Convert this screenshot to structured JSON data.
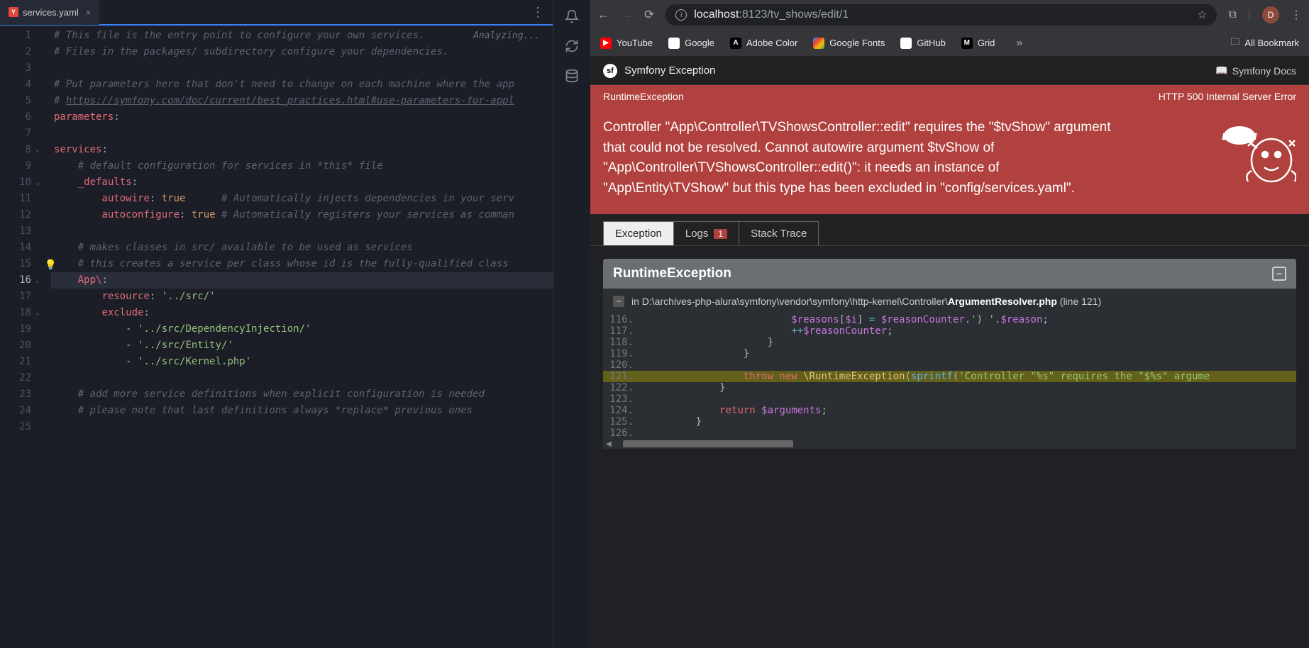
{
  "editor": {
    "tab": {
      "filename": "services.yaml",
      "iconLetter": "Y"
    },
    "status": "Analyzing...",
    "lines": [
      {
        "n": 1,
        "seg": [
          [
            "c-comment",
            "# This file is the entry point to configure your own services."
          ]
        ]
      },
      {
        "n": 2,
        "seg": [
          [
            "c-comment",
            "# Files in the packages/ subdirectory configure your dependencies."
          ]
        ]
      },
      {
        "n": 3,
        "seg": []
      },
      {
        "n": 4,
        "seg": [
          [
            "c-comment",
            "# Put parameters here that don't need to change on each machine where the app"
          ]
        ]
      },
      {
        "n": 5,
        "seg": [
          [
            "c-comment",
            "# "
          ],
          [
            "c-link",
            "https://symfony.com/doc/current/best_practices.html#use-parameters-for-appl"
          ]
        ]
      },
      {
        "n": 6,
        "seg": [
          [
            "c-key",
            "parameters"
          ],
          [
            "c-punc",
            ":"
          ]
        ]
      },
      {
        "n": 7,
        "seg": []
      },
      {
        "n": 8,
        "chev": "v",
        "seg": [
          [
            "c-key",
            "services"
          ],
          [
            "c-punc",
            ":"
          ]
        ]
      },
      {
        "n": 9,
        "seg": [
          [
            "",
            "    "
          ],
          [
            "c-comment",
            "# default configuration for services in *this* file"
          ]
        ]
      },
      {
        "n": 10,
        "chev": "v",
        "seg": [
          [
            "",
            "    "
          ],
          [
            "c-key",
            "_defaults"
          ],
          [
            "c-punc",
            ":"
          ]
        ]
      },
      {
        "n": 11,
        "seg": [
          [
            "",
            "        "
          ],
          [
            "c-key",
            "autowire"
          ],
          [
            "c-punc",
            ": "
          ],
          [
            "c-val",
            "true"
          ],
          [
            "",
            "      "
          ],
          [
            "c-comment",
            "# Automatically injects dependencies in your serv"
          ]
        ]
      },
      {
        "n": 12,
        "seg": [
          [
            "",
            "        "
          ],
          [
            "c-key",
            "autoconfigure"
          ],
          [
            "c-punc",
            ": "
          ],
          [
            "c-val",
            "true"
          ],
          [
            "",
            " "
          ],
          [
            "c-comment",
            "# Automatically registers your services as comman"
          ]
        ]
      },
      {
        "n": 13,
        "seg": []
      },
      {
        "n": 14,
        "seg": [
          [
            "",
            "    "
          ],
          [
            "c-comment",
            "# makes classes in src/ available to be used as services"
          ]
        ]
      },
      {
        "n": 15,
        "bulb": true,
        "seg": [
          [
            "",
            "    "
          ],
          [
            "c-comment",
            "# this creates a service per class whose id is the fully-qualified class"
          ]
        ]
      },
      {
        "n": 16,
        "chev": "v",
        "active": true,
        "seg": [
          [
            "",
            "    "
          ],
          [
            "c-key",
            "App\\"
          ],
          [
            "c-punc",
            ":"
          ]
        ]
      },
      {
        "n": 17,
        "seg": [
          [
            "",
            "        "
          ],
          [
            "c-key",
            "resource"
          ],
          [
            "c-punc",
            ": "
          ],
          [
            "c-str",
            "'../src/'"
          ]
        ]
      },
      {
        "n": 18,
        "chev": "v",
        "seg": [
          [
            "",
            "        "
          ],
          [
            "c-key",
            "exclude"
          ],
          [
            "c-punc",
            ":"
          ]
        ]
      },
      {
        "n": 19,
        "seg": [
          [
            "",
            "            "
          ],
          [
            "c-punc",
            "- "
          ],
          [
            "c-str",
            "'../src/DependencyInjection/'"
          ]
        ]
      },
      {
        "n": 20,
        "seg": [
          [
            "",
            "            "
          ],
          [
            "c-punc",
            "- "
          ],
          [
            "c-str",
            "'../src/Entity/'"
          ]
        ]
      },
      {
        "n": 21,
        "seg": [
          [
            "",
            "            "
          ],
          [
            "c-punc",
            "- "
          ],
          [
            "c-str",
            "'../src/Kernel.php'"
          ]
        ]
      },
      {
        "n": 22,
        "seg": []
      },
      {
        "n": 23,
        "seg": [
          [
            "",
            "    "
          ],
          [
            "c-comment",
            "# add more service definitions when explicit configuration is needed"
          ]
        ]
      },
      {
        "n": 24,
        "seg": [
          [
            "",
            "    "
          ],
          [
            "c-comment",
            "# please note that last definitions always *replace* previous ones"
          ]
        ]
      },
      {
        "n": 25,
        "seg": []
      }
    ]
  },
  "browser": {
    "url_host": "localhost",
    "url_path": ":8123/tv_shows/edit/1",
    "avatar_letter": "D",
    "bookmarks": [
      {
        "icon": "fi-yt",
        "label": "YouTube",
        "glyph": "▶"
      },
      {
        "icon": "fi-gg",
        "label": "Google",
        "glyph": "G"
      },
      {
        "icon": "fi-ac",
        "label": "Adobe Color",
        "glyph": "A"
      },
      {
        "icon": "fi-gf",
        "label": "Google Fonts",
        "glyph": ""
      },
      {
        "icon": "fi-gh",
        "label": "GitHub",
        "glyph": "○"
      },
      {
        "icon": "fi-gr",
        "label": "Grid",
        "glyph": "M"
      }
    ],
    "all_bookmarks_label": "All Bookmark"
  },
  "symfony": {
    "header_title": "Symfony Exception",
    "docs_label": "Symfony Docs",
    "banner_left": "RuntimeException",
    "banner_right": "HTTP 500 Internal Server Error",
    "message": "Controller \"App\\Controller\\TVShowsController::edit\" requires the \"$tvShow\" argument that could not be resolved. Cannot autowire argument $tvShow of \"App\\Controller\\TVShowsController::edit()\": it needs an instance of \"App\\Entity\\TVShow\" but this type has been excluded in \"config/services.yaml\".",
    "tabs": {
      "exception": "Exception",
      "logs": "Logs",
      "logs_badge": "1",
      "stack": "Stack Trace"
    },
    "exc_title": "RuntimeException",
    "trace_prefix": "in ",
    "trace_path": "D:\\archives-php-alura\\symfony\\vendor\\symfony\\http-kernel\\Controller\\",
    "trace_file": "ArgumentResolver.php",
    "trace_line_label": " (line 121)",
    "code": [
      {
        "n": "116.",
        "hl": false,
        "seg": [
          [
            "",
            "                        "
          ],
          [
            "p-var",
            "$reasons"
          ],
          [
            "p-punc",
            "["
          ],
          [
            "p-var",
            "$i"
          ],
          [
            "p-punc",
            "] "
          ],
          [
            "p-op",
            "="
          ],
          [
            "",
            " "
          ],
          [
            "p-var",
            "$reasonCounter"
          ],
          [
            "p-punc",
            "."
          ],
          [
            "p-str",
            "') '"
          ],
          [
            "p-punc",
            "."
          ],
          [
            "p-var",
            "$reason"
          ],
          [
            "p-punc",
            ";"
          ]
        ]
      },
      {
        "n": "117.",
        "hl": false,
        "seg": [
          [
            "",
            "                        "
          ],
          [
            "p-op",
            "++"
          ],
          [
            "p-var",
            "$reasonCounter"
          ],
          [
            "p-punc",
            ";"
          ]
        ]
      },
      {
        "n": "118.",
        "hl": false,
        "seg": [
          [
            "",
            "                    "
          ],
          [
            "p-punc",
            "}"
          ]
        ]
      },
      {
        "n": "119.",
        "hl": false,
        "seg": [
          [
            "",
            "                "
          ],
          [
            "p-punc",
            "}"
          ]
        ]
      },
      {
        "n": "120.",
        "hl": false,
        "seg": []
      },
      {
        "n": "121.",
        "hl": true,
        "seg": [
          [
            "",
            "                "
          ],
          [
            "p-kw",
            "throw new"
          ],
          [
            "",
            " "
          ],
          [
            "p-cls",
            "\\RuntimeException"
          ],
          [
            "p-punc",
            "("
          ],
          [
            "p-fn",
            "sprintf"
          ],
          [
            "p-punc",
            "("
          ],
          [
            "p-str",
            "'Controller \"%s\" requires the \"$%s\" argume"
          ]
        ]
      },
      {
        "n": "122.",
        "hl": false,
        "seg": [
          [
            "",
            "            "
          ],
          [
            "p-punc",
            "}"
          ]
        ]
      },
      {
        "n": "123.",
        "hl": false,
        "seg": []
      },
      {
        "n": "124.",
        "hl": false,
        "seg": [
          [
            "",
            "            "
          ],
          [
            "p-kw",
            "return"
          ],
          [
            "",
            " "
          ],
          [
            "p-var",
            "$arguments"
          ],
          [
            "p-punc",
            ";"
          ]
        ]
      },
      {
        "n": "125.",
        "hl": false,
        "seg": [
          [
            "",
            "        "
          ],
          [
            "p-punc",
            "}"
          ]
        ]
      },
      {
        "n": "126.",
        "hl": false,
        "seg": []
      }
    ]
  }
}
